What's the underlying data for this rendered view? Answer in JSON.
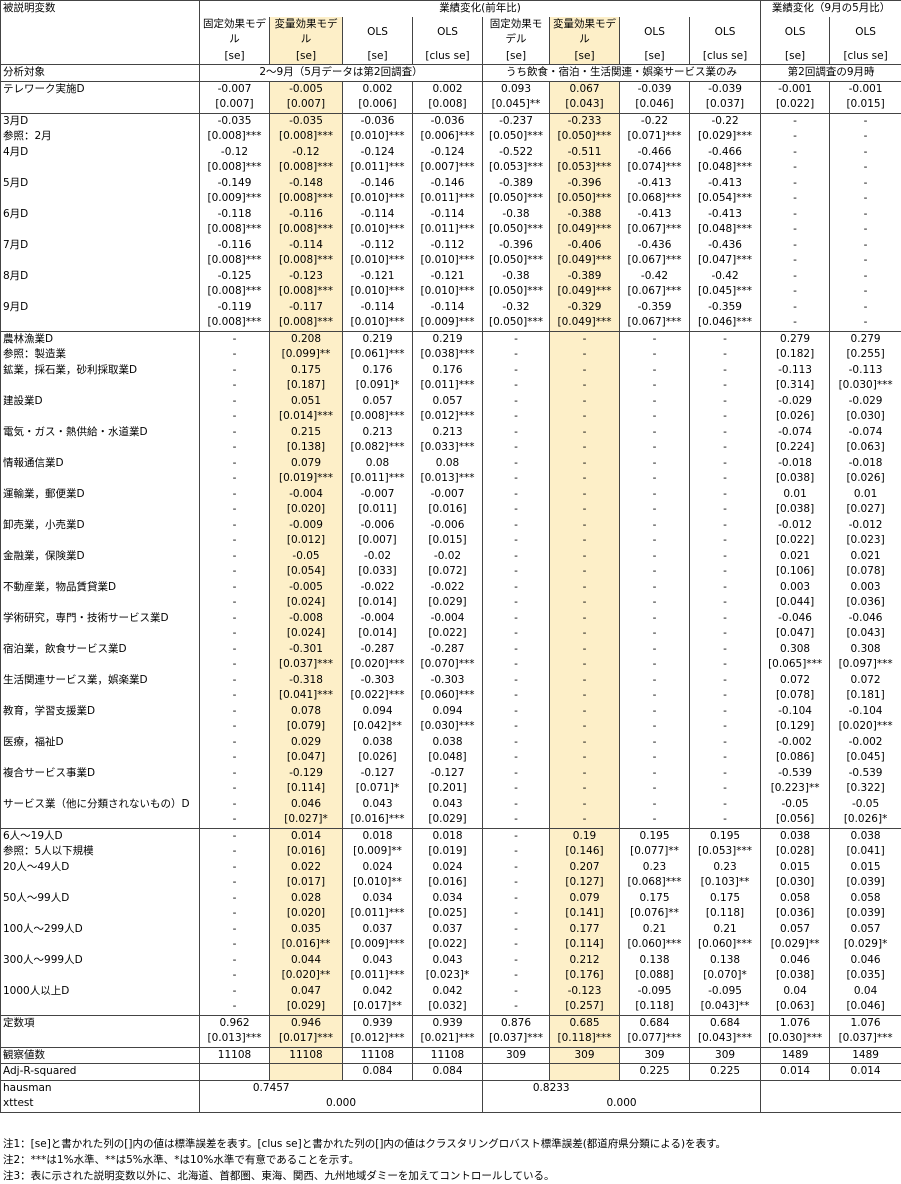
{
  "header": {
    "dep_var_label": "被説明変数",
    "group1_title": "業績変化(前年比)",
    "group2_title": "業績変化（9月の5月比）",
    "columns": [
      {
        "name": "固定効果モデル",
        "se": "[se]"
      },
      {
        "name": "変量効果モデル",
        "se": "[se]"
      },
      {
        "name": "OLS",
        "se": "[se]"
      },
      {
        "name": "OLS",
        "se": "[clus se]"
      },
      {
        "name": "固定効果モデル",
        "se": "[se]"
      },
      {
        "name": "変量効果モデル",
        "se": "[se]"
      },
      {
        "name": "OLS",
        "se": "[se]"
      },
      {
        "name": "OLS",
        "se": "[clus se]"
      },
      {
        "name": "OLS",
        "se": "[se]"
      },
      {
        "name": "OLS",
        "se": "[clus se]"
      }
    ],
    "sample_label": "分析対象",
    "sample_a": "2～9月（5月データは第2回調査）",
    "sample_b": "うち飲食・宿泊・生活関連・娯楽サービス業のみ",
    "sample_c": "第2回調査の9月時"
  },
  "rows": [
    {
      "label": "テレワーク実施D",
      "c": [
        "-0.007",
        "-0.005",
        "0.002",
        "0.002",
        "0.093",
        "0.067",
        "-0.039",
        "-0.039",
        "-0.001",
        "-0.001"
      ],
      "top": true
    },
    {
      "label": "",
      "c": [
        "[0.007]",
        "[0.007]",
        "[0.006]",
        "[0.008]",
        "[0.045]**",
        "[0.043]",
        "[0.046]",
        "[0.037]",
        "[0.022]",
        "[0.015]"
      ]
    },
    {
      "label": "3月D",
      "c": [
        "-0.035",
        "-0.035",
        "-0.036",
        "-0.036",
        "-0.237",
        "-0.233",
        "-0.22",
        "-0.22",
        "-",
        "-"
      ],
      "top": true
    },
    {
      "label": "参照：2月",
      "c": [
        "[0.008]***",
        "[0.008]***",
        "[0.010]***",
        "[0.006]***",
        "[0.050]***",
        "[0.050]***",
        "[0.071]***",
        "[0.029]***",
        "-",
        "-"
      ]
    },
    {
      "label": "4月D",
      "c": [
        "-0.12",
        "-0.12",
        "-0.124",
        "-0.124",
        "-0.522",
        "-0.511",
        "-0.466",
        "-0.466",
        "-",
        "-"
      ]
    },
    {
      "label": "",
      "c": [
        "[0.008]***",
        "[0.008]***",
        "[0.011]***",
        "[0.007]***",
        "[0.053]***",
        "[0.053]***",
        "[0.074]***",
        "[0.048]***",
        "-",
        "-"
      ]
    },
    {
      "label": "5月D",
      "c": [
        "-0.149",
        "-0.148",
        "-0.146",
        "-0.146",
        "-0.389",
        "-0.396",
        "-0.413",
        "-0.413",
        "-",
        "-"
      ]
    },
    {
      "label": "",
      "c": [
        "[0.009]***",
        "[0.008]***",
        "[0.010]***",
        "[0.011]***",
        "[0.050]***",
        "[0.050]***",
        "[0.068]***",
        "[0.054]***",
        "-",
        "-"
      ]
    },
    {
      "label": "6月D",
      "c": [
        "-0.118",
        "-0.116",
        "-0.114",
        "-0.114",
        "-0.38",
        "-0.388",
        "-0.413",
        "-0.413",
        "-",
        "-"
      ]
    },
    {
      "label": "",
      "c": [
        "[0.008]***",
        "[0.008]***",
        "[0.010]***",
        "[0.011]***",
        "[0.050]***",
        "[0.049]***",
        "[0.067]***",
        "[0.048]***",
        "-",
        "-"
      ]
    },
    {
      "label": "7月D",
      "c": [
        "-0.116",
        "-0.114",
        "-0.112",
        "-0.112",
        "-0.396",
        "-0.406",
        "-0.436",
        "-0.436",
        "-",
        "-"
      ]
    },
    {
      "label": "",
      "c": [
        "[0.008]***",
        "[0.008]***",
        "[0.010]***",
        "[0.010]***",
        "[0.050]***",
        "[0.049]***",
        "[0.067]***",
        "[0.047]***",
        "-",
        "-"
      ]
    },
    {
      "label": "8月D",
      "c": [
        "-0.125",
        "-0.123",
        "-0.121",
        "-0.121",
        "-0.38",
        "-0.389",
        "-0.42",
        "-0.42",
        "-",
        "-"
      ]
    },
    {
      "label": "",
      "c": [
        "[0.008]***",
        "[0.008]***",
        "[0.010]***",
        "[0.010]***",
        "[0.050]***",
        "[0.049]***",
        "[0.067]***",
        "[0.045]***",
        "-",
        "-"
      ]
    },
    {
      "label": "9月D",
      "c": [
        "-0.119",
        "-0.117",
        "-0.114",
        "-0.114",
        "-0.32",
        "-0.329",
        "-0.359",
        "-0.359",
        "-",
        "-"
      ]
    },
    {
      "label": "",
      "c": [
        "[0.008]***",
        "[0.008]***",
        "[0.010]***",
        "[0.009]***",
        "[0.050]***",
        "[0.049]***",
        "[0.067]***",
        "[0.046]***",
        "-",
        "-"
      ]
    },
    {
      "label": "農林漁業D",
      "c": [
        "-",
        "0.208",
        "0.219",
        "0.219",
        "-",
        "-",
        "-",
        "-",
        "0.279",
        "0.279"
      ],
      "top": true
    },
    {
      "label": "参照：製造業",
      "c": [
        "-",
        "[0.099]**",
        "[0.061]***",
        "[0.038]***",
        "-",
        "-",
        "-",
        "-",
        "[0.182]",
        "[0.255]"
      ]
    },
    {
      "label": "鉱業，採石業，砂利採取業D",
      "c": [
        "-",
        "0.175",
        "0.176",
        "0.176",
        "-",
        "-",
        "-",
        "-",
        "-0.113",
        "-0.113"
      ]
    },
    {
      "label": "",
      "c": [
        "-",
        "[0.187]",
        "[0.091]*",
        "[0.011]***",
        "-",
        "-",
        "-",
        "-",
        "[0.314]",
        "[0.030]***"
      ]
    },
    {
      "label": "建設業D",
      "c": [
        "-",
        "0.051",
        "0.057",
        "0.057",
        "-",
        "-",
        "-",
        "-",
        "-0.029",
        "-0.029"
      ]
    },
    {
      "label": "",
      "c": [
        "-",
        "[0.014]***",
        "[0.008]***",
        "[0.012]***",
        "-",
        "-",
        "-",
        "-",
        "[0.026]",
        "[0.030]"
      ]
    },
    {
      "label": "電気・ガス・熱供給・水道業D",
      "c": [
        "-",
        "0.215",
        "0.213",
        "0.213",
        "-",
        "-",
        "-",
        "-",
        "-0.074",
        "-0.074"
      ]
    },
    {
      "label": "",
      "c": [
        "-",
        "[0.138]",
        "[0.082]***",
        "[0.033]***",
        "-",
        "-",
        "-",
        "-",
        "[0.224]",
        "[0.063]"
      ]
    },
    {
      "label": "情報通信業D",
      "c": [
        "-",
        "0.079",
        "0.08",
        "0.08",
        "-",
        "-",
        "-",
        "-",
        "-0.018",
        "-0.018"
      ]
    },
    {
      "label": "",
      "c": [
        "-",
        "[0.019]***",
        "[0.011]***",
        "[0.013]***",
        "-",
        "-",
        "-",
        "-",
        "[0.038]",
        "[0.026]"
      ]
    },
    {
      "label": "運輸業，郵便業D",
      "c": [
        "-",
        "-0.004",
        "-0.007",
        "-0.007",
        "-",
        "-",
        "-",
        "-",
        "0.01",
        "0.01"
      ]
    },
    {
      "label": "",
      "c": [
        "-",
        "[0.020]",
        "[0.011]",
        "[0.016]",
        "-",
        "-",
        "-",
        "-",
        "[0.038]",
        "[0.027]"
      ]
    },
    {
      "label": "卸売業，小売業D",
      "c": [
        "-",
        "-0.009",
        "-0.006",
        "-0.006",
        "-",
        "-",
        "-",
        "-",
        "-0.012",
        "-0.012"
      ]
    },
    {
      "label": "",
      "c": [
        "-",
        "[0.012]",
        "[0.007]",
        "[0.015]",
        "-",
        "-",
        "-",
        "-",
        "[0.022]",
        "[0.023]"
      ]
    },
    {
      "label": "金融業，保険業D",
      "c": [
        "-",
        "-0.05",
        "-0.02",
        "-0.02",
        "-",
        "-",
        "-",
        "-",
        "0.021",
        "0.021"
      ]
    },
    {
      "label": "",
      "c": [
        "-",
        "[0.054]",
        "[0.033]",
        "[0.072]",
        "-",
        "-",
        "-",
        "-",
        "[0.106]",
        "[0.078]"
      ]
    },
    {
      "label": "不動産業，物品賃貸業D",
      "c": [
        "-",
        "-0.005",
        "-0.022",
        "-0.022",
        "-",
        "-",
        "-",
        "-",
        "0.003",
        "0.003"
      ]
    },
    {
      "label": "",
      "c": [
        "-",
        "[0.024]",
        "[0.014]",
        "[0.029]",
        "-",
        "-",
        "-",
        "-",
        "[0.044]",
        "[0.036]"
      ]
    },
    {
      "label": "学術研究，専門・技術サービス業D",
      "c": [
        "-",
        "-0.008",
        "-0.004",
        "-0.004",
        "-",
        "-",
        "-",
        "-",
        "-0.046",
        "-0.046"
      ]
    },
    {
      "label": "",
      "c": [
        "-",
        "[0.024]",
        "[0.014]",
        "[0.022]",
        "-",
        "-",
        "-",
        "-",
        "[0.047]",
        "[0.043]"
      ]
    },
    {
      "label": "宿泊業，飲食サービス業D",
      "c": [
        "-",
        "-0.301",
        "-0.287",
        "-0.287",
        "-",
        "-",
        "-",
        "-",
        "0.308",
        "0.308"
      ]
    },
    {
      "label": "",
      "c": [
        "-",
        "[0.037]***",
        "[0.020]***",
        "[0.070]***",
        "-",
        "-",
        "-",
        "-",
        "[0.065]***",
        "[0.097]***"
      ]
    },
    {
      "label": "生活関連サービス業，娯楽業D",
      "c": [
        "-",
        "-0.318",
        "-0.303",
        "-0.303",
        "-",
        "-",
        "-",
        "-",
        "0.072",
        "0.072"
      ]
    },
    {
      "label": "",
      "c": [
        "-",
        "[0.041]***",
        "[0.022]***",
        "[0.060]***",
        "-",
        "-",
        "-",
        "-",
        "[0.078]",
        "[0.181]"
      ]
    },
    {
      "label": "教育，学習支援業D",
      "c": [
        "-",
        "0.078",
        "0.094",
        "0.094",
        "-",
        "-",
        "-",
        "-",
        "-0.104",
        "-0.104"
      ]
    },
    {
      "label": "",
      "c": [
        "-",
        "[0.079]",
        "[0.042]**",
        "[0.030]***",
        "-",
        "-",
        "-",
        "-",
        "[0.129]",
        "[0.020]***"
      ]
    },
    {
      "label": "医療，福祉D",
      "c": [
        "-",
        "0.029",
        "0.038",
        "0.038",
        "-",
        "-",
        "-",
        "-",
        "-0.002",
        "-0.002"
      ]
    },
    {
      "label": "",
      "c": [
        "-",
        "[0.047]",
        "[0.026]",
        "[0.048]",
        "-",
        "-",
        "-",
        "-",
        "[0.086]",
        "[0.045]"
      ]
    },
    {
      "label": "複合サービス事業D",
      "c": [
        "-",
        "-0.129",
        "-0.127",
        "-0.127",
        "-",
        "-",
        "-",
        "-",
        "-0.539",
        "-0.539"
      ]
    },
    {
      "label": "",
      "c": [
        "-",
        "[0.114]",
        "[0.071]*",
        "[0.201]",
        "-",
        "-",
        "-",
        "-",
        "[0.223]**",
        "[0.322]"
      ]
    },
    {
      "label": "サービス業（他に分類されないもの）D",
      "c": [
        "-",
        "0.046",
        "0.043",
        "0.043",
        "-",
        "-",
        "-",
        "-",
        "-0.05",
        "-0.05"
      ]
    },
    {
      "label": "",
      "c": [
        "-",
        "[0.027]*",
        "[0.016]***",
        "[0.029]",
        "-",
        "-",
        "-",
        "-",
        "[0.056]",
        "[0.026]*"
      ]
    },
    {
      "label": "6人～19人D",
      "c": [
        "-",
        "0.014",
        "0.018",
        "0.018",
        "-",
        "0.19",
        "0.195",
        "0.195",
        "0.038",
        "0.038"
      ],
      "top": true
    },
    {
      "label": "参照：5人以下規模",
      "c": [
        "-",
        "[0.016]",
        "[0.009]**",
        "[0.019]",
        "-",
        "[0.146]",
        "[0.077]**",
        "[0.053]***",
        "[0.028]",
        "[0.041]"
      ]
    },
    {
      "label": "20人～49人D",
      "c": [
        "-",
        "0.022",
        "0.024",
        "0.024",
        "-",
        "0.207",
        "0.23",
        "0.23",
        "0.015",
        "0.015"
      ]
    },
    {
      "label": "",
      "c": [
        "-",
        "[0.017]",
        "[0.010]**",
        "[0.016]",
        "-",
        "[0.127]",
        "[0.068]***",
        "[0.103]**",
        "[0.030]",
        "[0.039]"
      ]
    },
    {
      "label": "50人～99人D",
      "c": [
        "-",
        "0.028",
        "0.034",
        "0.034",
        "-",
        "0.079",
        "0.175",
        "0.175",
        "0.058",
        "0.058"
      ]
    },
    {
      "label": "",
      "c": [
        "-",
        "[0.020]",
        "[0.011]***",
        "[0.025]",
        "-",
        "[0.141]",
        "[0.076]**",
        "[0.118]",
        "[0.036]",
        "[0.039]"
      ]
    },
    {
      "label": "100人～299人D",
      "c": [
        "-",
        "0.035",
        "0.037",
        "0.037",
        "-",
        "0.177",
        "0.21",
        "0.21",
        "0.057",
        "0.057"
      ]
    },
    {
      "label": "",
      "c": [
        "-",
        "[0.016]**",
        "[0.009]***",
        "[0.022]",
        "-",
        "[0.114]",
        "[0.060]***",
        "[0.060]***",
        "[0.029]**",
        "[0.029]*"
      ]
    },
    {
      "label": "300人～999人D",
      "c": [
        "-",
        "0.044",
        "0.043",
        "0.043",
        "-",
        "0.212",
        "0.138",
        "0.138",
        "0.046",
        "0.046"
      ]
    },
    {
      "label": "",
      "c": [
        "-",
        "[0.020]**",
        "[0.011]***",
        "[0.023]*",
        "-",
        "[0.176]",
        "[0.088]",
        "[0.070]*",
        "[0.038]",
        "[0.035]"
      ]
    },
    {
      "label": "1000人以上D",
      "c": [
        "-",
        "0.047",
        "0.042",
        "0.042",
        "-",
        "-0.123",
        "-0.095",
        "-0.095",
        "0.04",
        "0.04"
      ]
    },
    {
      "label": "",
      "c": [
        "-",
        "[0.029]",
        "[0.017]**",
        "[0.032]",
        "-",
        "[0.257]",
        "[0.118]",
        "[0.043]**",
        "[0.063]",
        "[0.046]"
      ]
    },
    {
      "label": "定数項",
      "c": [
        "0.962",
        "0.946",
        "0.939",
        "0.939",
        "0.876",
        "0.685",
        "0.684",
        "0.684",
        "1.076",
        "1.076"
      ],
      "top": true
    },
    {
      "label": "",
      "c": [
        "[0.013]***",
        "[0.017]***",
        "[0.012]***",
        "[0.021]***",
        "[0.037]***",
        "[0.118]***",
        "[0.077]***",
        "[0.043]***",
        "[0.030]***",
        "[0.037]***"
      ]
    },
    {
      "label": "観察値数",
      "c": [
        "11108",
        "11108",
        "11108",
        "11108",
        "309",
        "309",
        "309",
        "309",
        "1489",
        "1489"
      ],
      "top": true
    },
    {
      "label": "Adj-R-squared",
      "c": [
        "",
        "",
        "0.084",
        "0.084",
        "",
        "",
        "0.225",
        "0.225",
        "0.014",
        "0.014"
      ],
      "top": true
    }
  ],
  "tests": {
    "hausman_label": "hausman",
    "hausman_a": "0.7457",
    "hausman_b": "0.8233",
    "xttest_label": "xttest",
    "xttest_a": "0.000",
    "xttest_b": "0.000"
  },
  "notes": [
    "注1：[se]と書かれた列の[]内の値は標準誤差を表す。[clus se]と書かれた列の[]内の値はクラスタリングロバスト標準誤差(都道府県分類による)を表す。",
    "注2：***は1%水準、**は5%水準、*は10%水準で有意であることを示す。",
    "注3：表に示された説明変数以外に、北海道、首都圏、東海、関西、九州地域ダミーを加えてコントロールしている。"
  ],
  "colors": {
    "highlight": "#fdefc8",
    "border": "#444444"
  }
}
